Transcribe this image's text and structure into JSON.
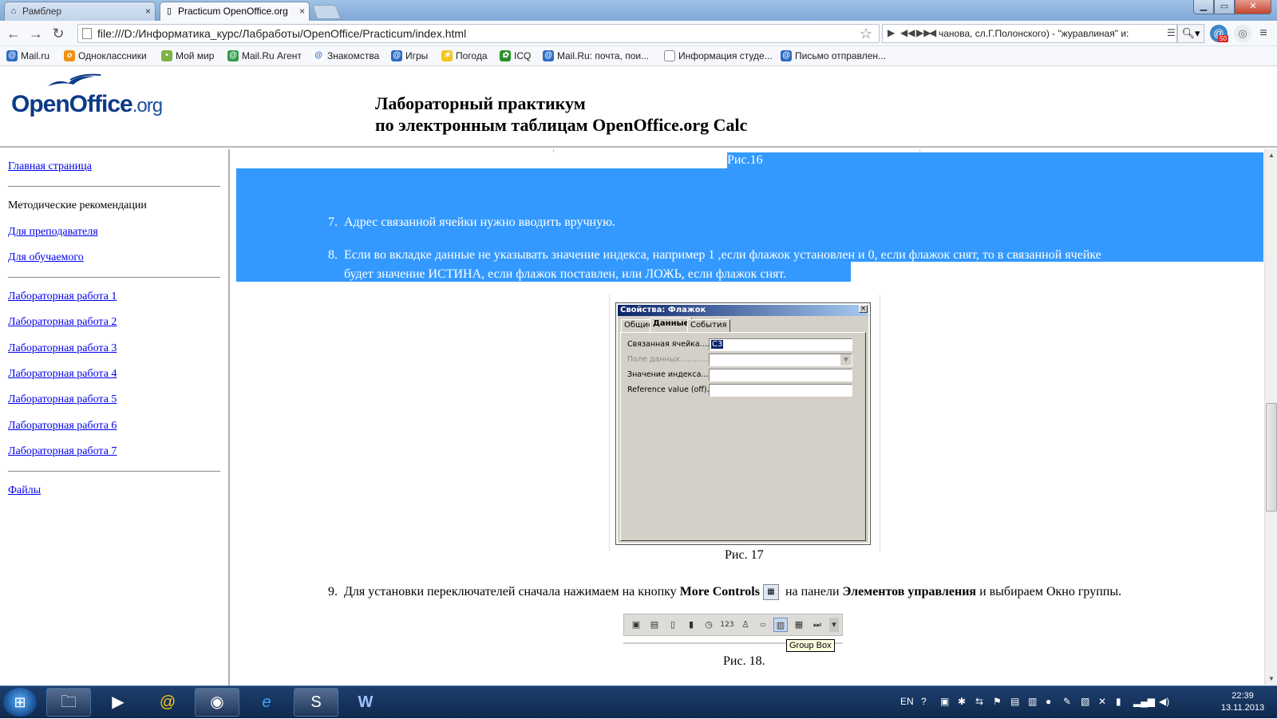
{
  "browser": {
    "tabs": [
      {
        "label": "Рамблер",
        "icon": "home-icon"
      },
      {
        "label": "Practicum OpenOffice.org",
        "icon": "page-icon"
      }
    ],
    "close_glyph": "×",
    "url": "file:///D:/Информатика_курс/Лабработы/OpenOffice/Practicum/index.html",
    "media_text": "чанова, сл.Г.Полонского) - \"журавлиная\" и:",
    "bookmarks": [
      "Mail.ru",
      "Одноклассники",
      "Мой мир",
      "Mail.Ru Агент",
      "Знакомства",
      "Игры",
      "Погода",
      "ICQ",
      "Mail.Ru: почта, пои...",
      "Информация студе...",
      "Письмо отправлен..."
    ],
    "badge_count": "50"
  },
  "header": {
    "logo_main": "OpenOffice",
    "logo_suffix": ".org",
    "title_line1": "Лабораторный практикум",
    "title_line2": "по электронным таблицам OpenOffice.org Calc"
  },
  "sidebar": {
    "home": "Главная страница",
    "section": "Методические рекомендации",
    "for_teacher": "Для преподавателя",
    "for_student": "Для обучаемого",
    "labs": [
      "Лабораторная работа 1",
      "Лабораторная работа 2",
      "Лабораторная работа 3",
      "Лабораторная работа 4",
      "Лабораторная работа 5",
      "Лабораторная работа 6",
      "Лабораторная работа 7"
    ],
    "files": "Файлы"
  },
  "content": {
    "fig16": "Рис.16",
    "items": [
      {
        "num": "7.",
        "text": "Адрес связанной ячейки нужно вводить вручную."
      },
      {
        "num": "8.",
        "line1": "Если во вкладке данные не указывать значение индекса, например 1 ,если флажок установлен и 0, если флажок снят, то в связанной ячейке",
        "line2": "будет значение ИСТИНА, если флажок поставлен, или ЛОЖЬ, если флажок снят."
      }
    ],
    "dialog": {
      "title": "Свойства: Флажок",
      "tabs": [
        "Общие",
        "Данные",
        "События"
      ],
      "fields": [
        {
          "label": "Связанная ячейка........",
          "value": "C3"
        },
        {
          "label": "Поле данных...............",
          "value": ""
        },
        {
          "label": "Значение индекса........",
          "value": ""
        },
        {
          "label": "Reference value (off).....",
          "value": ""
        }
      ]
    },
    "fig17": "Рис. 17",
    "item9": {
      "num": "9.",
      "pre": "Для установки переключателей сначала нажимаем на кнопку ",
      "bold1": "More Controls",
      "mid": " на панели ",
      "bold2": "Элементов управления",
      "post": " и выбираем Окно группы."
    },
    "control_icons": [
      "image-control-icon",
      "file-control-icon",
      "cursor-icon",
      "numeric-field-icon",
      "clock-icon",
      "123",
      "currency-icon",
      "formatted-field-icon",
      "group-box-icon",
      "table-control-icon",
      "navigation-bar-icon"
    ],
    "numeric_glyph": "123",
    "tooltip": "Group Box",
    "fig18": "Рис. 18."
  },
  "taskbar": {
    "lang": "EN",
    "time": "22:39",
    "date": "13.11.2013"
  }
}
